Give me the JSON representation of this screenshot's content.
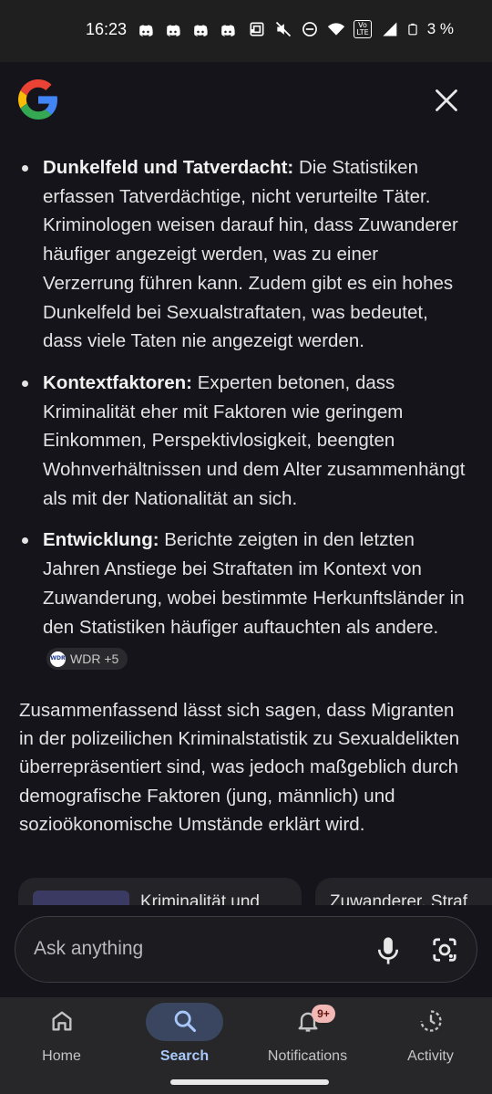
{
  "status_bar": {
    "time": "16:23",
    "battery_percent": "3 %",
    "network_badge": [
      "Vo",
      "LTE"
    ],
    "left_icons": [
      "discord-icon",
      "discord-icon",
      "discord-icon",
      "discord-icon",
      "dot-icon"
    ],
    "right_icons": [
      "nfc-icon",
      "mute-icon",
      "dnd-icon",
      "wifi-icon",
      "lte-icon",
      "signal-icon",
      "battery-icon"
    ]
  },
  "header": {
    "logo": "google-g-icon",
    "close_icon": "close-icon"
  },
  "bullets": [
    {
      "title": "Dunkelfeld und Tatverdacht:",
      "text": " Die Statistiken erfassen Tatverdächtige, nicht verurteilte Täter. Kriminologen weisen darauf hin, dass Zuwanderer häufiger angezeigt werden, was zu einer Verzerrung führen kann. Zudem gibt es ein hohes Dunkelfeld bei Sexualstraftaten, was bedeutet, dass viele Taten nie angezeigt werden."
    },
    {
      "title": "Kontextfaktoren:",
      "text": " Experten betonen, dass Kriminalität eher mit Faktoren wie geringem Einkommen, Perspektivlosigkeit, beengten Wohnverhältnissen und dem Alter zusammenhängt als mit der Nationalität an sich."
    },
    {
      "title": "Entwicklung:",
      "text": " Berichte zeigten in den letzten Jahren Anstiege bei Straftaten im Kontext von Zuwanderung, wobei bestimmte Herkunftsländer in den Statistiken häufiger auftauchten als andere.",
      "source_chip": {
        "logo_text": "WDR",
        "label": "WDR +5"
      }
    }
  ],
  "summary": "Zusammenfassend lässt sich sagen, dass Migranten in der polizeilichen Kriminalstatistik zu Sexualdelikten überrepräsentiert sind, was jedoch maßgeblich durch demografische Faktoren (jung, männlich) und sozioökonomische Umstände erklärt wird.",
  "cards": [
    {
      "title": "Kriminalität und"
    },
    {
      "title": "Zuwanderer, Straf"
    }
  ],
  "search": {
    "placeholder": "Ask anything",
    "icons": [
      "mic-icon",
      "lens-icon"
    ]
  },
  "bottom_nav": {
    "items": [
      {
        "label": "Home",
        "icon": "home-icon",
        "active": false
      },
      {
        "label": "Search",
        "icon": "search-icon",
        "active": true
      },
      {
        "label": "Notifications",
        "icon": "bell-icon",
        "active": false,
        "badge": "9+"
      },
      {
        "label": "Activity",
        "icon": "activity-icon",
        "active": false
      }
    ]
  },
  "colors": {
    "background": "#14141a",
    "status_bar": "#1f1f1f",
    "nav_bar": "#272729",
    "active_accent": "#a8c7fa",
    "badge": "#f2b8b5"
  }
}
